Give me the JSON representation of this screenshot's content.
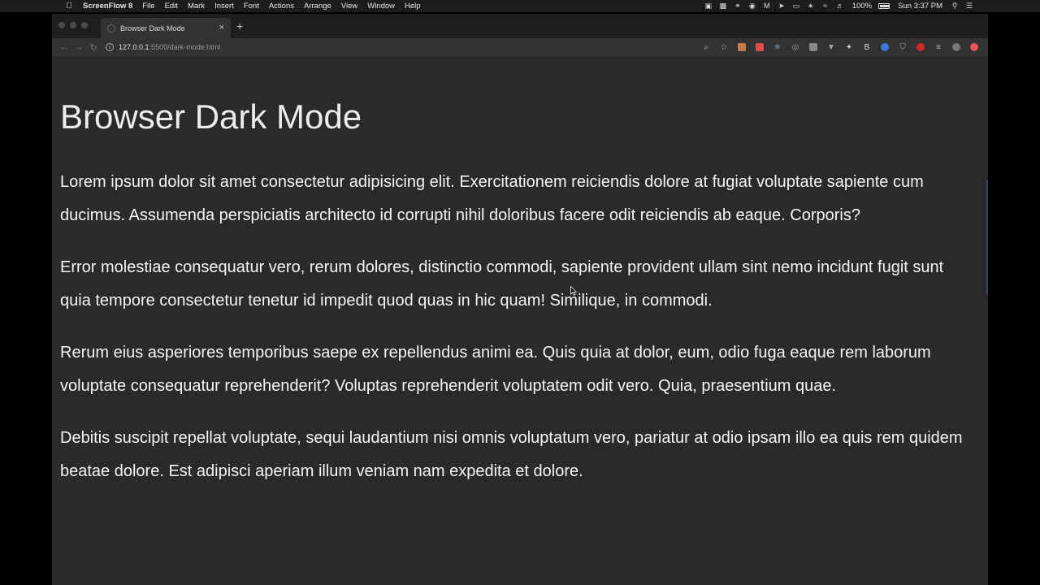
{
  "menubar": {
    "app_name": "ScreenFlow 8",
    "items": [
      "File",
      "Edit",
      "Mark",
      "Insert",
      "Font",
      "Actions",
      "Arrange",
      "View",
      "Window",
      "Help"
    ],
    "battery_text": "100%",
    "battery_level": 1.0,
    "clock": "Sun 3:37 PM",
    "status_icons": [
      "docker-icon",
      "camera-icon",
      "creative-cloud-icon",
      "location-icon",
      "malwarebytes-icon",
      "send-icon",
      "airplay-icon",
      "bluetooth-icon",
      "wifi-icon",
      "volume-icon"
    ]
  },
  "browser": {
    "tab": {
      "title": "Browser Dark Mode",
      "close": "×"
    },
    "new_tab": "+",
    "url": {
      "host": "127.0.0.1",
      "path": ":5500/dark-mode.html"
    },
    "extension_icons": [
      {
        "name": "zoom-icon",
        "color": "#bbbbbb",
        "glyph": "⌕"
      },
      {
        "name": "bookmark-star-icon",
        "color": "#bbbbbb",
        "glyph": "☆"
      },
      {
        "name": "extension-box-icon",
        "color": "#c77b4a",
        "glyph": ""
      },
      {
        "name": "color-picker-icon",
        "color": "#e24a4a",
        "glyph": ""
      },
      {
        "name": "react-devtools-icon",
        "color": "#9ec9e8",
        "glyph": "⚛"
      },
      {
        "name": "target-icon",
        "color": "#9a9a9a",
        "glyph": "◎"
      },
      {
        "name": "square-extension-icon",
        "color": "#888888",
        "glyph": ""
      },
      {
        "name": "vue-devtools-icon",
        "color": "#aaaaaa",
        "glyph": "▼"
      },
      {
        "name": "bird-icon",
        "color": "#cccccc",
        "glyph": "✦"
      },
      {
        "name": "b-extension-icon",
        "color": "#dddddd",
        "glyph": "B"
      },
      {
        "name": "blue-circle-icon",
        "color": "#3b78d8",
        "glyph": ""
      },
      {
        "name": "pocket-icon",
        "color": "#aaaaaa",
        "glyph": "⛉"
      },
      {
        "name": "pinterest-icon",
        "color": "#d02a2a",
        "glyph": ""
      },
      {
        "name": "menu-lines-icon",
        "color": "#bbbbbb",
        "glyph": "≡"
      },
      {
        "name": "profile-avatar-icon",
        "color": "#777777",
        "glyph": ""
      },
      {
        "name": "red-badge-icon",
        "color": "#e8555a",
        "glyph": ""
      }
    ]
  },
  "page": {
    "title": "Browser Dark Mode",
    "paragraphs": [
      "Lorem ipsum dolor sit amet consectetur adipisicing elit. Exercitationem reiciendis dolore at fugiat voluptate sapiente cum ducimus. Assumenda perspiciatis architecto id corrupti nihil doloribus facere odit reiciendis ab eaque. Corporis?",
      "Error molestiae consequatur vero, rerum dolores, distinctio commodi, sapiente provident ullam sint nemo incidunt fugit sunt quia tempore consectetur tenetur id impedit quod quas in hic quam! Similique, in commodi.",
      "Rerum eius asperiores temporibus saepe ex repellendus animi ea. Quis quia at dolor, eum, odio fuga eaque rem laborum voluptate consequatur reprehenderit? Voluptas reprehenderit voluptatem odit vero. Quia, praesentium quae.",
      "Debitis suscipit repellat voluptate, sequi laudantium nisi omnis voluptatum vero, pariatur at odio ipsam illo ea quis rem quidem beatae dolore. Est adipisci aperiam illum veniam nam expedita et dolore."
    ]
  }
}
